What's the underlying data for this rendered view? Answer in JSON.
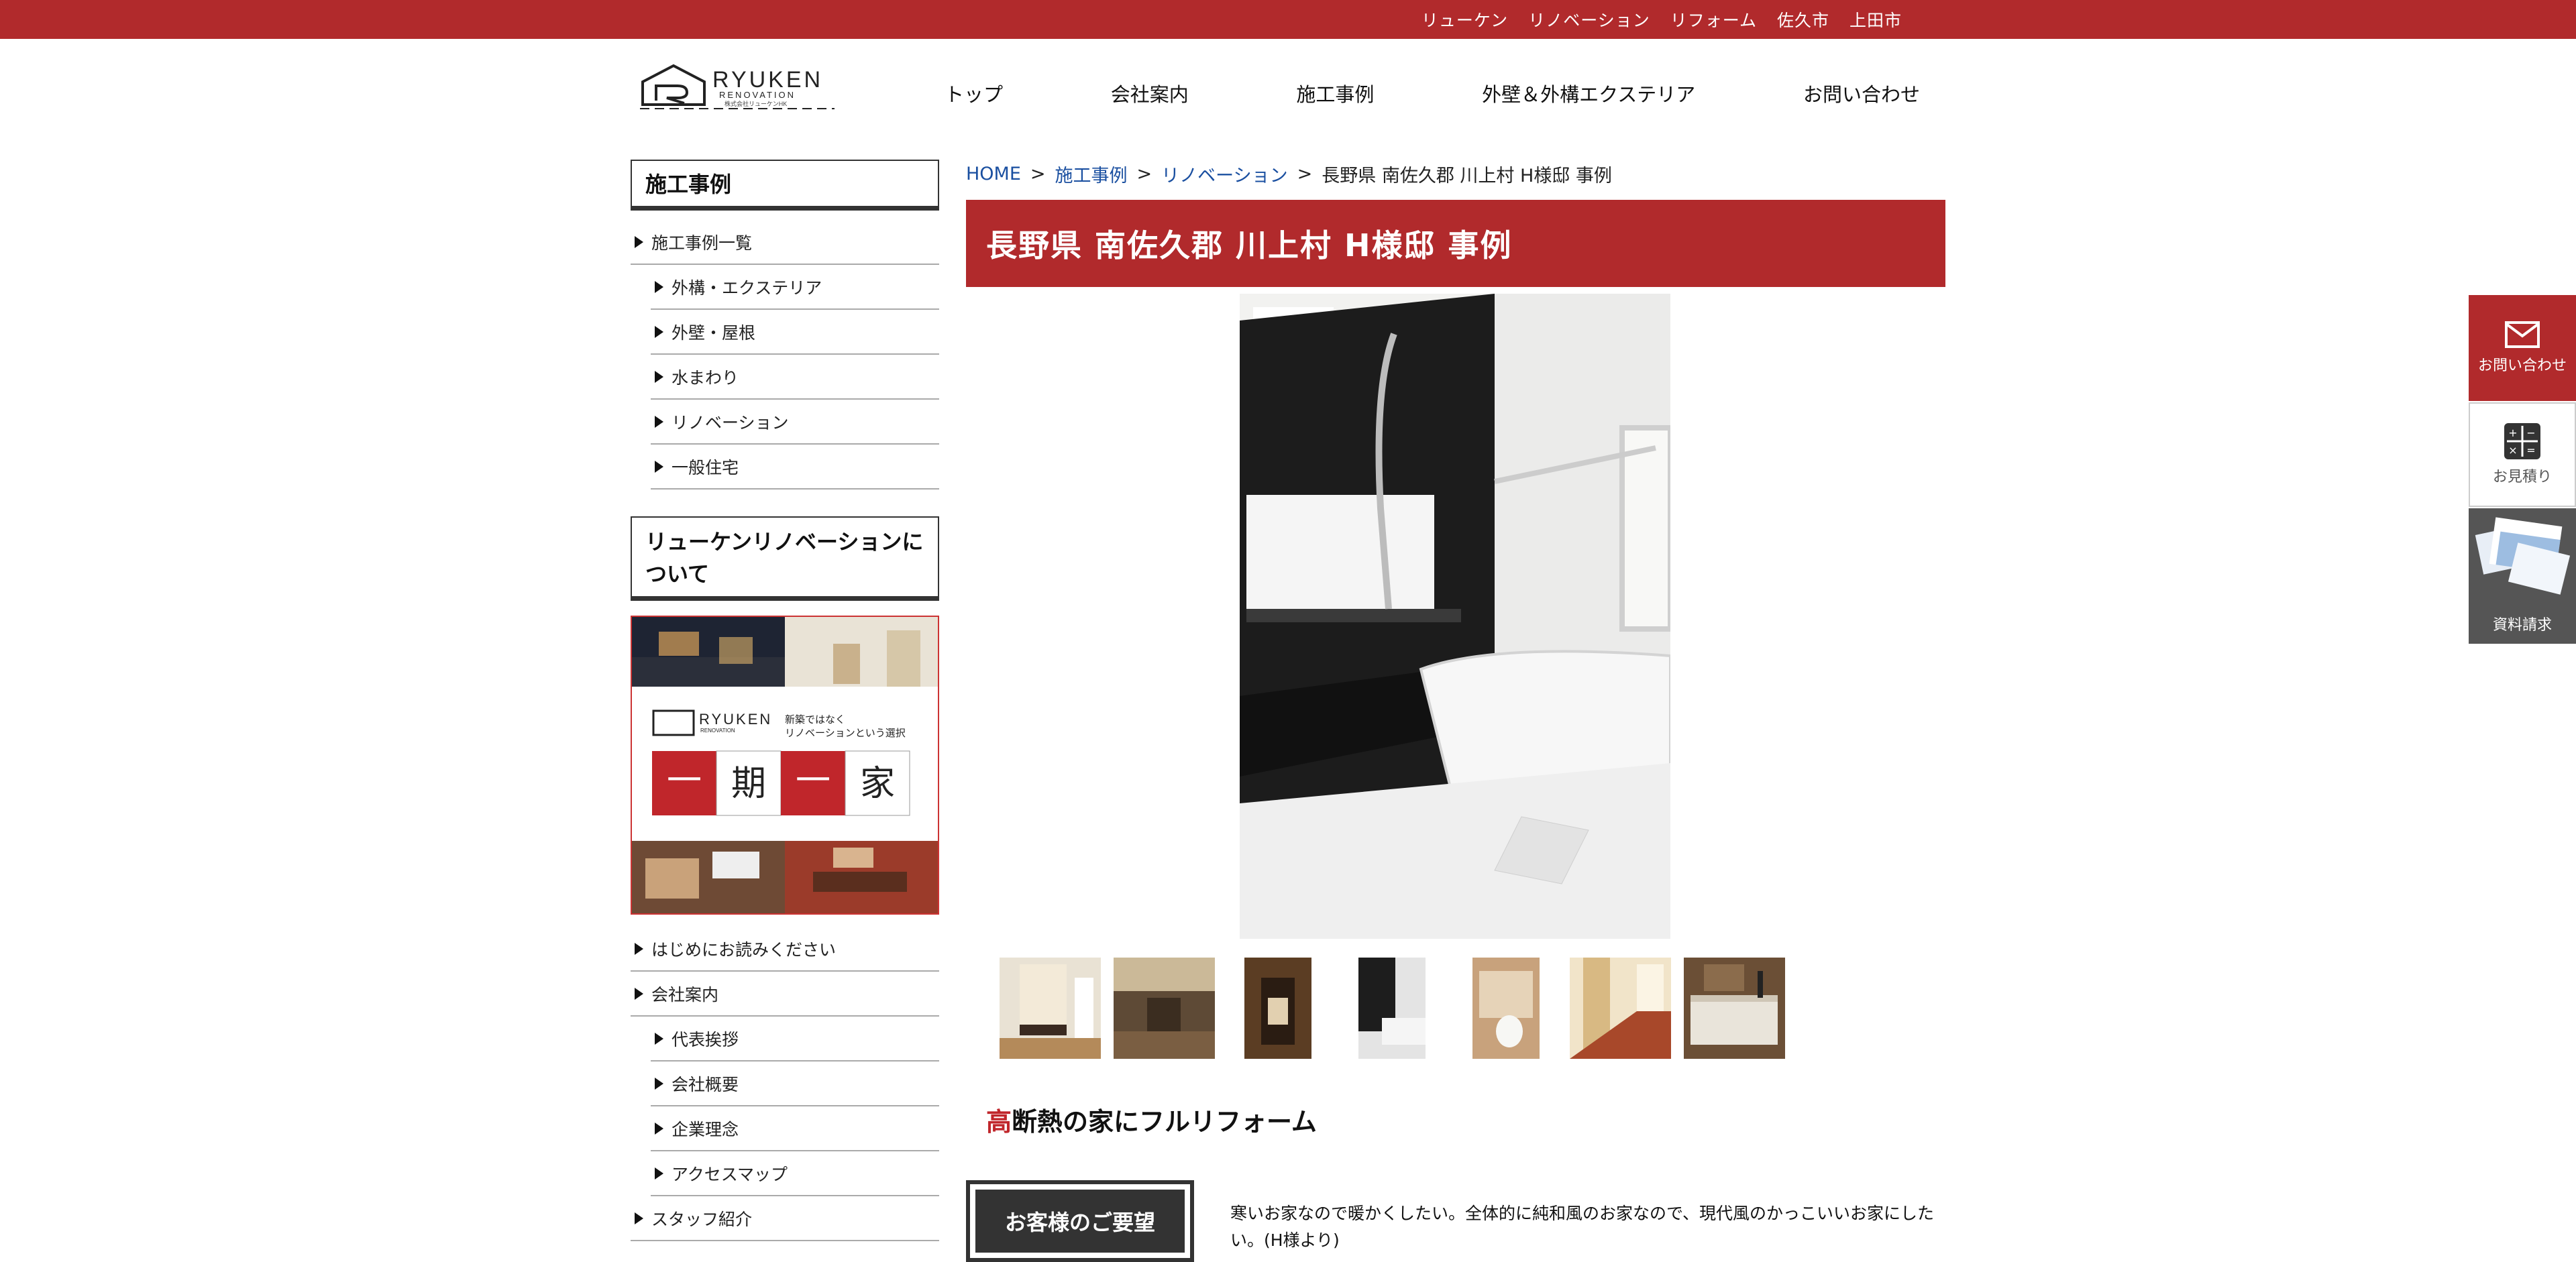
{
  "topbar": {
    "links": [
      "リューケン",
      "リノベーション",
      "リフォーム",
      "佐久市",
      "上田市"
    ]
  },
  "header": {
    "logo_text": "RYUKEN",
    "logo_subtext": "RENOVATION",
    "logo_small": "株式会社リューケンHK",
    "nav": [
      "トップ",
      "会社案内",
      "施工事例",
      "外壁＆外構エクステリア",
      "お問い合わせ"
    ]
  },
  "sidebar": {
    "heading1": "施工事例",
    "list1": [
      {
        "label": "施工事例一覧",
        "sub": false
      },
      {
        "label": "外構・エクステリア",
        "sub": true
      },
      {
        "label": "外壁・屋根",
        "sub": true
      },
      {
        "label": "水まわり",
        "sub": true
      },
      {
        "label": "リノベーション",
        "sub": true
      },
      {
        "label": "一般住宅",
        "sub": true
      }
    ],
    "heading2": "リューケンリノベーションについて",
    "banner": {
      "brand": "RYUKEN",
      "brand_sub": "RENOVATION",
      "tagline1": "新築ではなく",
      "tagline2": "リノベーションという選択",
      "chars": [
        "一",
        "期",
        "一",
        "家"
      ]
    },
    "list2": [
      {
        "label": "はじめにお読みください",
        "sub": false
      },
      {
        "label": "会社案内",
        "sub": false
      },
      {
        "label": "代表挨拶",
        "sub": true
      },
      {
        "label": "会社概要",
        "sub": true
      },
      {
        "label": "企業理念",
        "sub": true
      },
      {
        "label": "アクセスマップ",
        "sub": true
      },
      {
        "label": "スタッフ紹介",
        "sub": false
      }
    ]
  },
  "breadcrumb": {
    "home": "HOME",
    "cat": "施工事例",
    "subcat": "リノベーション",
    "current": "長野県 南佐久郡 川上村 H様邸 事例",
    "sep": ">"
  },
  "page_title": "長野県 南佐久郡 川上村 H様邸 事例",
  "section": {
    "accent": "高",
    "rest": "断熱の家にフルリフォーム"
  },
  "request": {
    "label": "お客様のご要望",
    "text": "寒いお家なので暖かくしたい。全体的に純和風のお家なので、現代風のかっこいいお家にしたい。(H様より)"
  },
  "floating": {
    "contact": "お問い合わせ",
    "estimate": "お見積り",
    "docs": "資料請求"
  },
  "colors": {
    "brand_red": "#b12a2c",
    "link_blue": "#1a4fa0",
    "dark": "#333333"
  }
}
